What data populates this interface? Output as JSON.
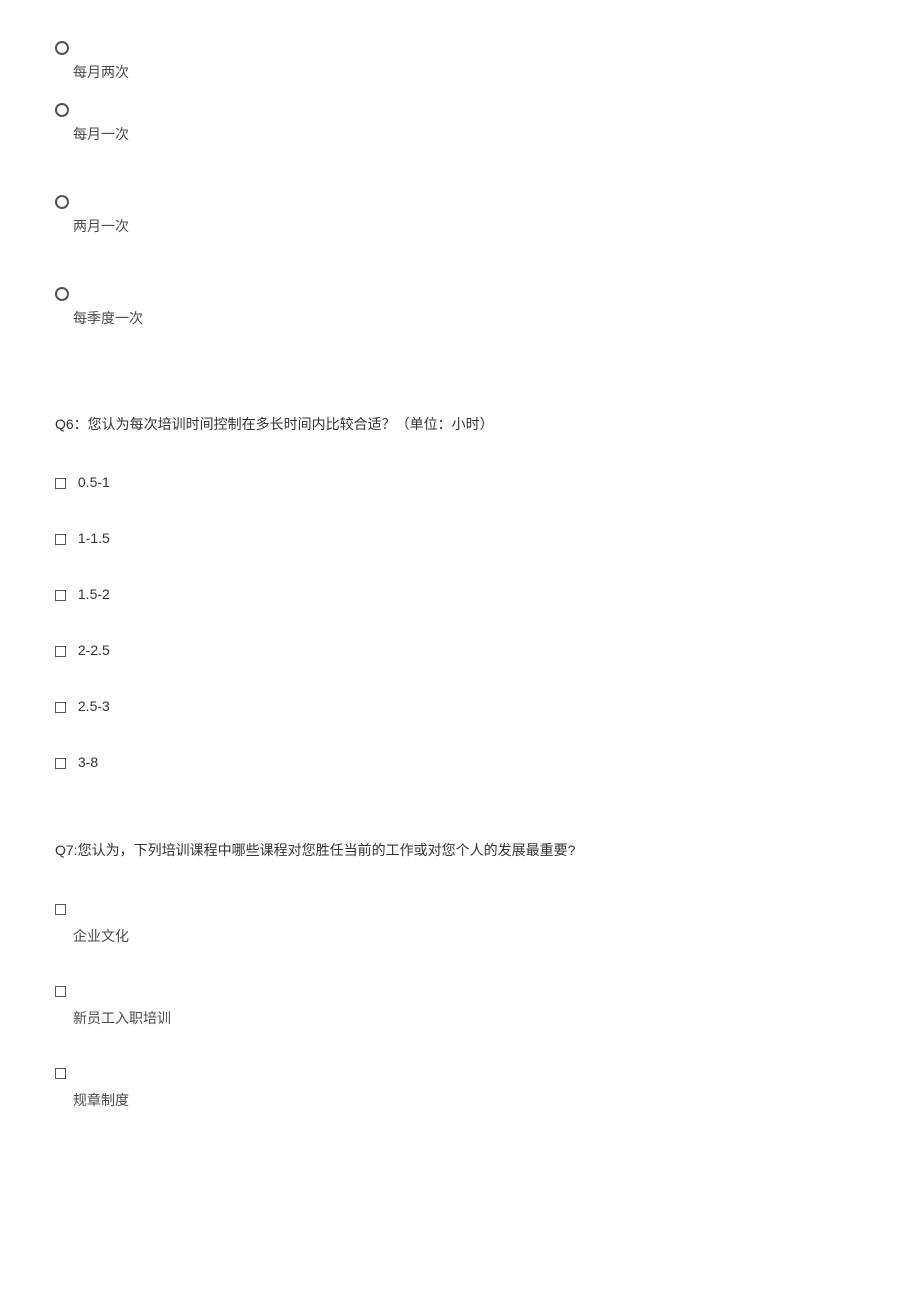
{
  "q5": {
    "options": [
      {
        "label": "每月两次",
        "gap": false
      },
      {
        "label": "每月一次",
        "gap": true
      },
      {
        "label": "两月一次",
        "gap": true
      },
      {
        "label": "每季度一次",
        "gap": false
      }
    ]
  },
  "q6": {
    "title": "Q6：您认为每次培训时间控制在多长时间内比较合适？（单位：小时）",
    "options": [
      {
        "label": "0.5-1"
      },
      {
        "label": "1-1.5"
      },
      {
        "label": "1.5-2"
      },
      {
        "label": "2-2.5"
      },
      {
        "label": "2.5-3"
      },
      {
        "label": "3-8"
      }
    ]
  },
  "q7": {
    "title": "Q7:您认为，下列培训课程中哪些课程对您胜任当前的工作或对您个人的发展最重要?",
    "options": [
      {
        "label": "企业文化"
      },
      {
        "label": "新员工入职培训"
      },
      {
        "label": "规章制度"
      }
    ]
  }
}
